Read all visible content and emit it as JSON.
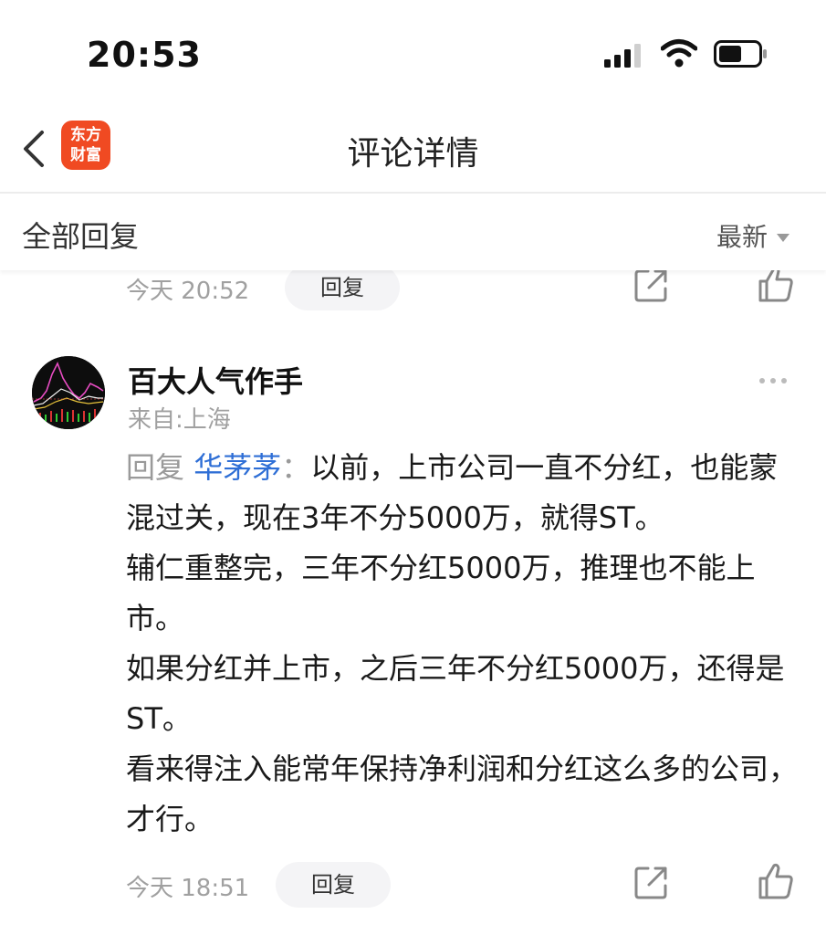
{
  "status_bar": {
    "time": "20:53"
  },
  "nav": {
    "title": "评论详情",
    "logo_line1": "东方",
    "logo_line2": "财富"
  },
  "section": {
    "title": "全部回复",
    "sort_label": "最新"
  },
  "previous_comment": {
    "time": "今天 20:52",
    "reply_label": "回复"
  },
  "comment": {
    "username": "百大人气作手",
    "location": "来自:上海",
    "reply_prefix": "回复",
    "reply_to": "华茅茅",
    "reply_colon": "：",
    "text": "以前，上市公司一直不分红，也能蒙混过关，现在3年不分5000万，就得ST。\n辅仁重整完，三年不分红5000万，推理也不能上市。\n如果分红并上市，之后三年不分红5000万，还得是ST。\n看来得注入能常年保持净利润和分红这么多的公司，才行。",
    "time": "今天 18:51",
    "reply_label": "回复"
  },
  "colors": {
    "accent_link": "#2f6fd6",
    "logo_bg": "#f04a22"
  }
}
